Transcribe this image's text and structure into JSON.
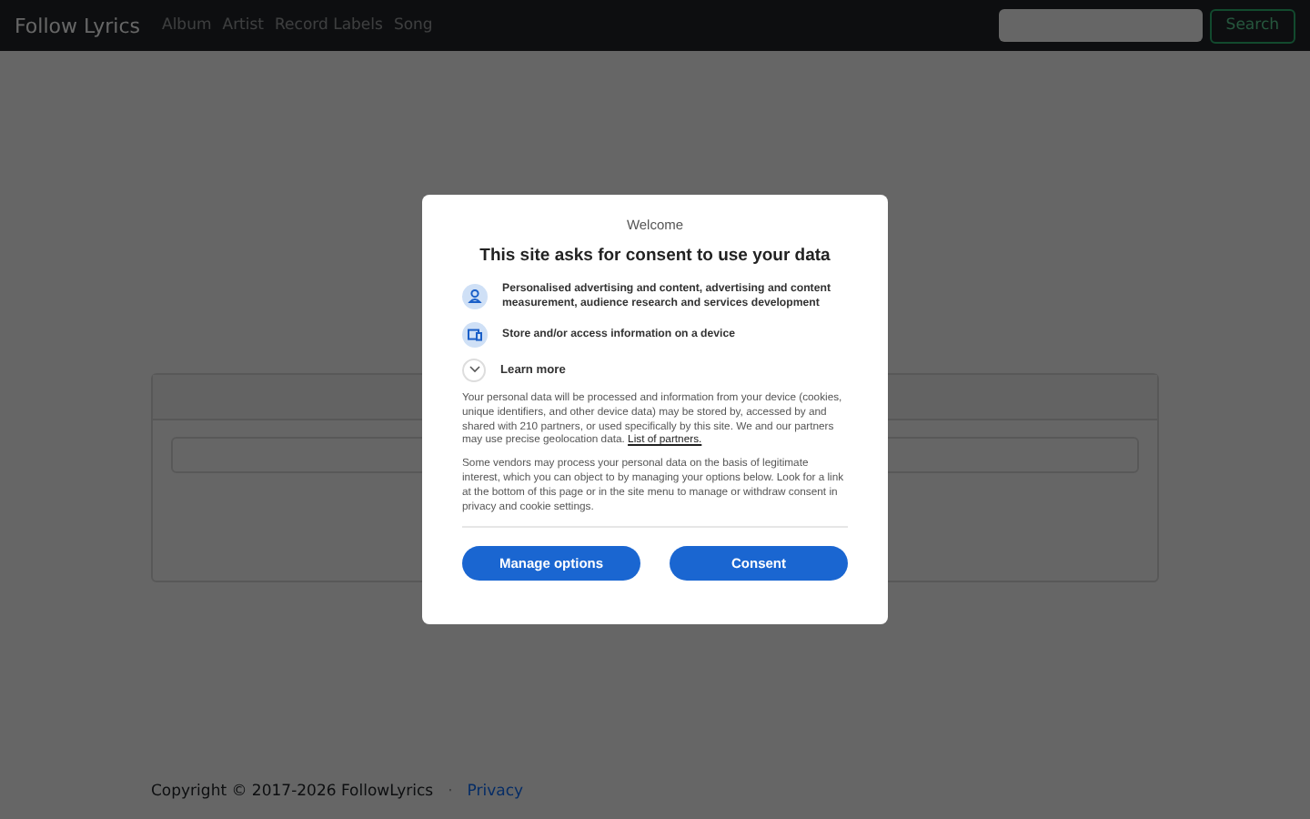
{
  "navbar": {
    "brand": "Follow Lyrics",
    "links": [
      "Album",
      "Artist",
      "Record Labels",
      "Song"
    ],
    "search": {
      "button": "Search"
    }
  },
  "footer": {
    "copyright": "Copyright © 2017-2026 FollowLyrics",
    "separator": "·",
    "link": "Privacy"
  },
  "consent_dialog": {
    "heading": "Welcome",
    "title": "This site asks for consent to use your data",
    "purposes": [
      {
        "kind": "person",
        "text": "Personalised advertising and content, advertising and content measurement, audience research and services development"
      },
      {
        "kind": "device",
        "text": "Store and/or access information on a device"
      }
    ],
    "learn_more": {
      "label": "Learn more",
      "expanded": false
    },
    "paragraphs": [
      "Your personal data will be processed and information from your device (cookies, unique identifiers, and other device data) may be stored by, accessed by and shared with 210 partners, or used specifically by this site. We and our partners may use precise geolocation data.",
      "Some vendors may process your personal data on the basis of legitimate interest, which you can object to by managing your options below. Look for a link at the bottom of this page or in the site menu to manage or withdraw consent in privacy and cookie settings."
    ],
    "partners_link": "List of partners.",
    "buttons": [
      "Manage options",
      "Consent"
    ]
  }
}
